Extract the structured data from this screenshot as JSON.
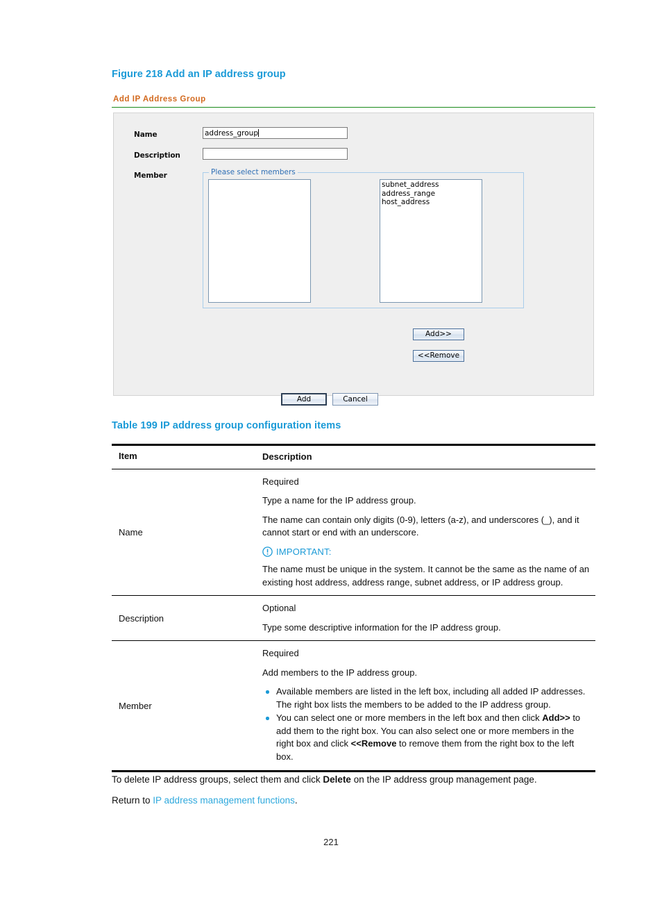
{
  "figure": {
    "caption": "Figure 218 Add an IP address group",
    "panel_title": "Add IP Address Group",
    "labels": {
      "name": "Name",
      "description": "Description",
      "member": "Member"
    },
    "inputs": {
      "name_value": "address_group",
      "name_placeholder": "",
      "description_value": "",
      "description_placeholder": ""
    },
    "fieldset_legend": "Please select members",
    "left_list": [],
    "right_list": [
      "subnet_address",
      "address_range",
      "host_address"
    ],
    "transfer_buttons": {
      "add": "Add>>",
      "remove": "<<Remove"
    },
    "action_buttons": {
      "submit": "Add",
      "cancel": "Cancel"
    }
  },
  "table": {
    "caption": "Table 199 IP address group configuration items",
    "headers": {
      "item": "Item",
      "description": "Description"
    },
    "rows": [
      {
        "item": "Name",
        "paragraphs": [
          "Required",
          "Type a name for the IP address group.",
          "The name can contain only digits (0-9), letters (a-z), and underscores (_), and it cannot start or end with an underscore."
        ],
        "important": {
          "label": "IMPORTANT:",
          "text": "The name must be unique in the system. It cannot be the same as the name of an existing host address, address range, subnet address, or IP address group."
        }
      },
      {
        "item": "Description",
        "paragraphs": [
          "Optional",
          "Type some descriptive information for the IP address group."
        ]
      },
      {
        "item": "Member",
        "paragraphs": [
          "Required",
          "Add members to the IP address group."
        ],
        "bullets": [
          {
            "pre": "Available members are listed in the left box, including all added IP addresses. The right box lists the members to be added to the IP address group.",
            "bold1": "",
            "mid": "",
            "bold2": "",
            "post": ""
          },
          {
            "pre": "You can select one or more members in the left box and then click ",
            "bold1": "Add>>",
            "mid": " to add them to the right box. You can also select one or more members in the right box and click ",
            "bold2": "<<Remove",
            "post": " to remove them from the right box to the left box."
          }
        ]
      }
    ]
  },
  "footer": {
    "delete_pre": "To delete IP address groups, select them and click ",
    "delete_bold": "Delete",
    "delete_post": " on the IP address group management page.",
    "return_pre": "Return to ",
    "return_link": "IP address management functions",
    "return_post": "."
  },
  "page_number": "221",
  "colors": {
    "caption_blue": "#1a9ad7",
    "panel_title_orange": "#d2691e",
    "panel_rule_green": "#1a8a1a",
    "link_blue": "#2fa9dd",
    "bullet_blue": "#1a9ad7"
  }
}
